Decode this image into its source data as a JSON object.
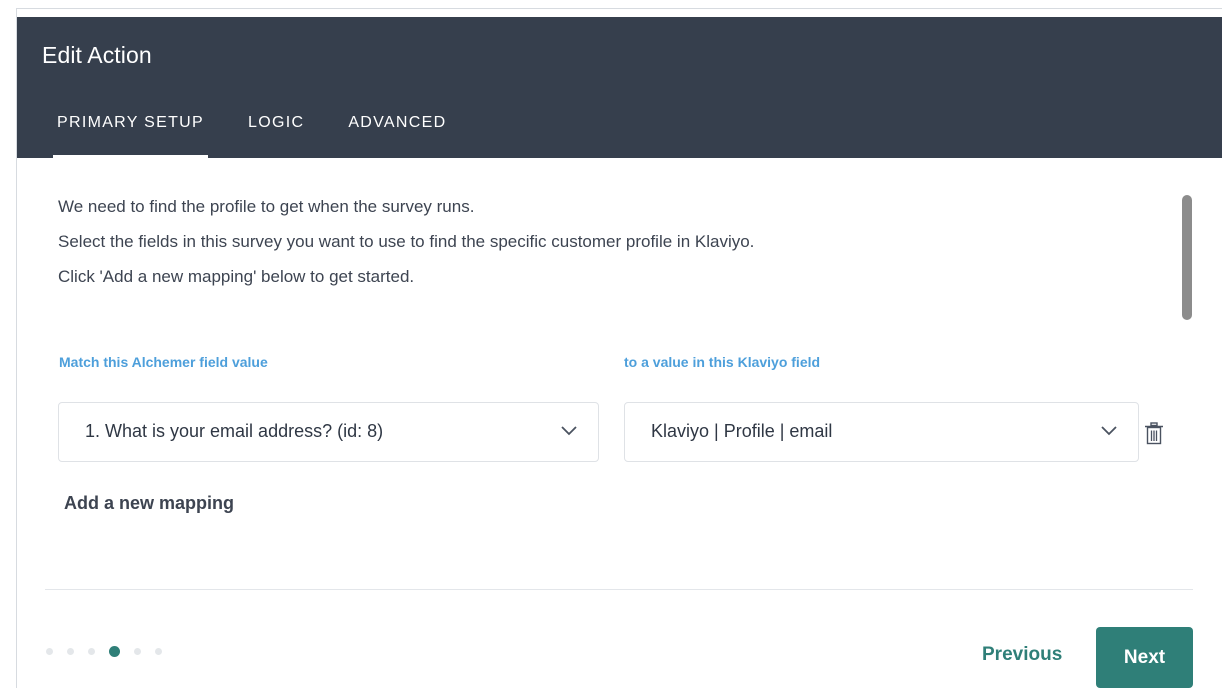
{
  "dialog": {
    "title": "Edit Action",
    "tabs": [
      {
        "label": "PRIMARY SETUP",
        "active": true
      },
      {
        "label": "LOGIC",
        "active": false
      },
      {
        "label": "ADVANCED",
        "active": false
      }
    ]
  },
  "intro": {
    "lines": [
      "We need to find the profile to get when the survey runs.",
      "Select the fields in this survey you want to use to find the specific customer profile in Klaviyo.",
      "Click 'Add a new mapping' below to get started."
    ]
  },
  "mapping": {
    "left_label": "Match this Alchemer field value",
    "right_label": "to a value in this Klaviyo field",
    "left_value": "1. What is your email address? (id: 8)",
    "right_value": "Klaviyo | Profile | email",
    "delete_icon": "trash-icon",
    "add_label": "Add a new mapping"
  },
  "footer": {
    "steps_total": 6,
    "step_current": 4,
    "previous_label": "Previous",
    "next_label": "Next"
  },
  "colors": {
    "header_bg": "#363f4d",
    "accent_label": "#4d9fdb",
    "primary": "#2f7f78"
  }
}
